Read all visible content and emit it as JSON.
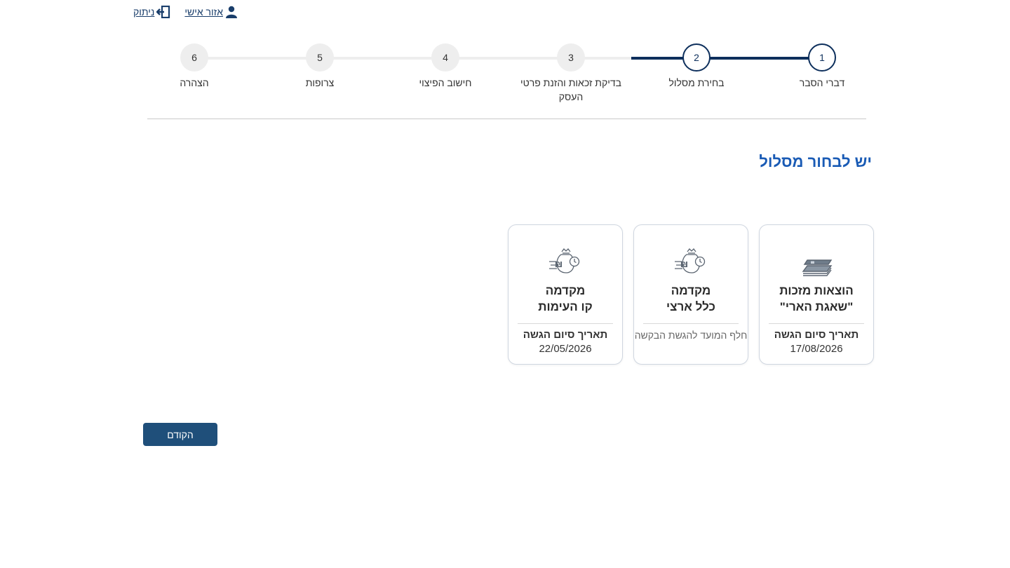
{
  "top_links": {
    "logout_label": "ניתוק",
    "personal_area_label": "אזור אישי"
  },
  "stepper": {
    "steps": [
      {
        "number": "1",
        "label": "דברי הסבר"
      },
      {
        "number": "2",
        "label": "בחירת מסלול"
      },
      {
        "number": "3",
        "label": "בדיקת זכאות והזנת פרטי העסק"
      },
      {
        "number": "4",
        "label": "חישוב הפיצוי"
      },
      {
        "number": "5",
        "label": "צרופות"
      },
      {
        "number": "6",
        "label": "הצהרה"
      }
    ],
    "current_step": 2
  },
  "main": {
    "heading": "יש לבחור מסלול",
    "cards": [
      {
        "icon": "banknotes-icon",
        "title_line1": "הוצאות מזכות",
        "title_line2": "\"שאגת הארי\"",
        "footer_label": "תאריך סיום הגשה",
        "footer_value": "17/08/2026"
      },
      {
        "icon": "money-bag-clock-icon",
        "title_line1": "מקדמה",
        "title_line2": "כלל ארצי",
        "footer_note": "חלף המועד להגשת הבקשה"
      },
      {
        "icon": "money-bag-clock-icon",
        "title_line1": "מקדמה",
        "title_line2": "קו העימות",
        "footer_label": "תאריך סיום הגשה",
        "footer_value": "22/05/2026"
      }
    ]
  },
  "footer": {
    "back_label": "הקודם"
  },
  "colors": {
    "primary_dark": "#0d2f5c",
    "heading_blue": "#1a5bb5",
    "button_bg": "#1f4f7a"
  }
}
